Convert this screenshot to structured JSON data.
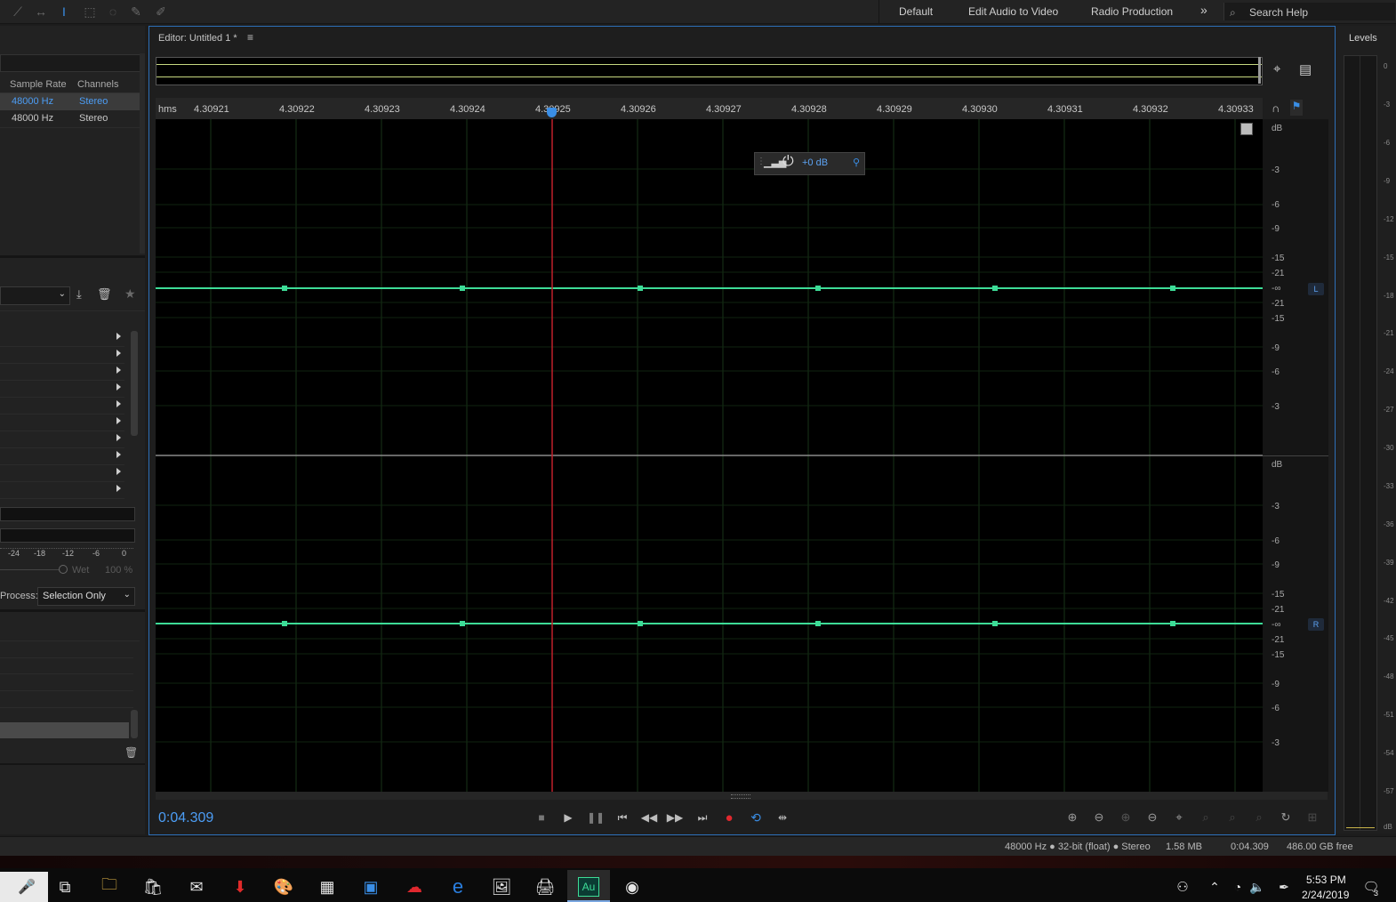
{
  "toolbar": {
    "workspaces": [
      "Default",
      "Edit Audio to Video",
      "Radio Production"
    ],
    "more_label": "»",
    "search_placeholder": "Search Help"
  },
  "files_panel": {
    "columns": [
      "Sample Rate",
      "Channels"
    ],
    "rows": [
      {
        "sample_rate": "48000 Hz",
        "channels": "Stereo",
        "selected": true
      },
      {
        "sample_rate": "48000 Hz",
        "channels": "Stereo",
        "selected": false
      }
    ]
  },
  "effects_panel": {
    "meter_ticks": [
      "-24",
      "-18",
      "-12",
      "-6",
      "0"
    ],
    "wet_label": "Wet",
    "wet_value": "100 %",
    "process_label": "Process:",
    "process_value": "Selection Only"
  },
  "editor": {
    "title": "Editor: Untitled 1 *",
    "ruler_unit": "hms",
    "ruler_ticks": [
      "4.30921",
      "4.30922",
      "4.30923",
      "4.30924",
      "4.30925",
      "4.30926",
      "4.30927",
      "4.30928",
      "4.30929",
      "4.30930",
      "4.30931",
      "4.30932",
      "4.30933"
    ],
    "hud_gain": "+0 dB",
    "db_unit": "dB",
    "db_labels_left": [
      "-3",
      "-6",
      "-9",
      "-15",
      "-21",
      "-∞",
      "-21",
      "-15",
      "-9",
      "-6",
      "-3"
    ],
    "db_labels_right": [
      "-3",
      "-6",
      "-9",
      "-15",
      "-21",
      "-∞",
      "-21",
      "-15",
      "-9",
      "-6",
      "-3"
    ],
    "channel_left": "L",
    "channel_right": "R",
    "current_time": "0:04.309"
  },
  "levels": {
    "title": "Levels",
    "scale": [
      "0",
      "-3",
      "-6",
      "-9",
      "-12",
      "-15",
      "-18",
      "-21",
      "-24",
      "-27",
      "-30",
      "-33",
      "-36",
      "-39",
      "-42",
      "-45",
      "-48",
      "-51",
      "-54",
      "-57",
      "dB"
    ]
  },
  "status": {
    "format": "48000 Hz ● 32-bit (float) ● Stereo",
    "size": "1.58 MB",
    "duration": "0:04.309",
    "free": "486.00 GB free"
  },
  "taskbar": {
    "time": "5:53 PM",
    "date": "2/24/2019",
    "notifications": "3",
    "audition_label": "Au"
  }
}
